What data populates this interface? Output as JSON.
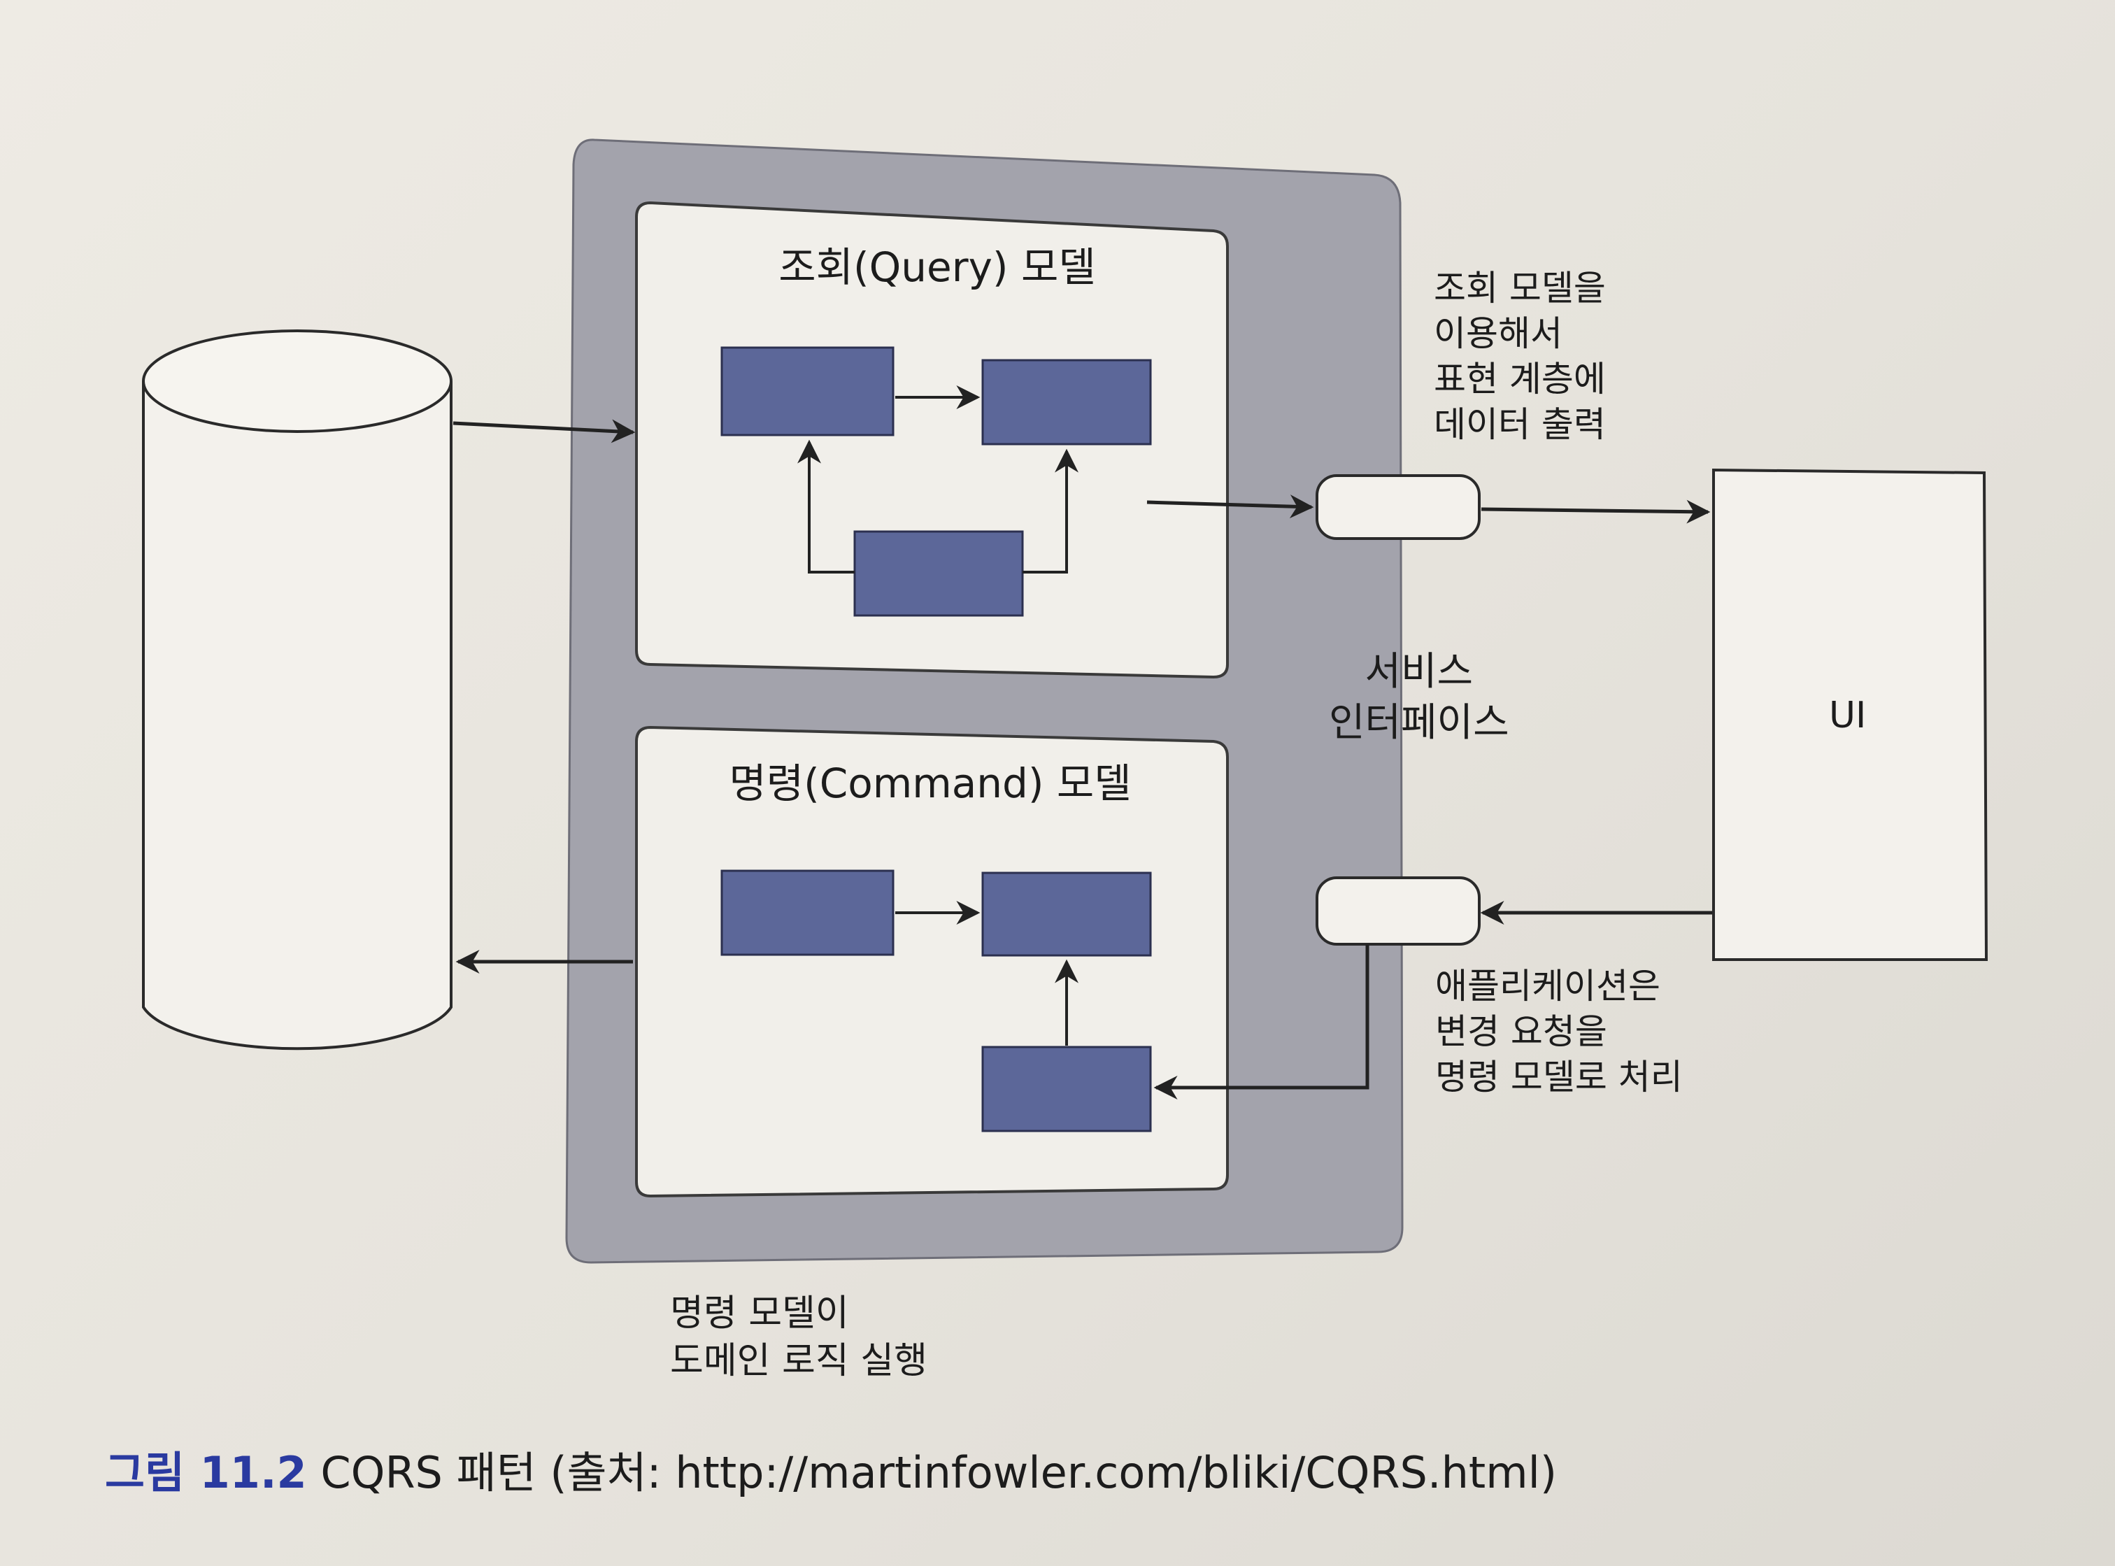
{
  "diagram": {
    "query_model_title": "조회(Query) 모델",
    "command_model_title": "명령(Command) 모델",
    "query_note": "조회 모델을\n이용해서\n표현 계층에\n데이터 출력",
    "service_interface_label": "서비스\n인터페이스",
    "ui_label": "UI",
    "command_note": "애플리케이션은\n변경 요청을\n명령 모델로 처리",
    "domain_note": "명령 모델이\n도메인 로직 실행"
  },
  "caption": {
    "label": "그림 11.2",
    "text": " CQRS 패턴 (출처: http://martinfowler.com/bliki/CQRS.html)"
  },
  "colors": {
    "outer_container": "#a3a3ac",
    "inner_panel": "#f1efea",
    "object_box": "#5c6799",
    "arrow": "#222222",
    "caption_label": "#2a3aa0"
  }
}
